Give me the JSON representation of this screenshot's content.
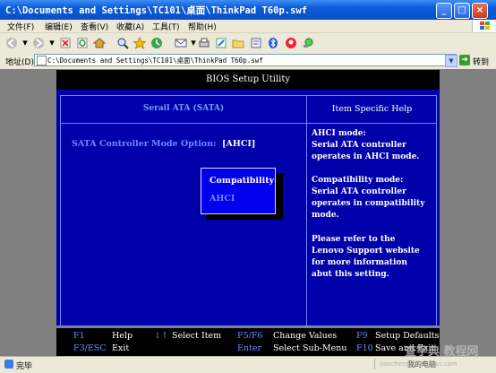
{
  "window": {
    "title": "C:\\Documents and Settings\\TC101\\桌面\\ThinkPad T60p.swf",
    "minimize": "_",
    "maximize": "□",
    "close": "×"
  },
  "menu": [
    "文件(F)",
    "编辑(E)",
    "查看(V)",
    "收藏(A)",
    "工具(T)",
    "帮助(H)"
  ],
  "address": {
    "label": "地址(D)",
    "value": "C:\\Documents and Settings\\TC101\\桌面\\ThinkPad T60p.swf",
    "go_label": "转到"
  },
  "toolbar_icons": [
    "back-icon",
    "forward-icon",
    "stop-icon",
    "refresh-icon",
    "home-icon",
    "search-icon",
    "favorites-icon",
    "history-icon",
    "mail-icon",
    "print-icon",
    "edit-icon",
    "folder-icon",
    "discuss-icon",
    "bluetooth-icon",
    "messenger-icon",
    "research-icon"
  ],
  "bios": {
    "title": "BIOS Setup Utility",
    "section_title": "Serail ATA (SATA)",
    "help_title": "Item Specific Help",
    "option_label": "SATA Controller Mode Option:",
    "option_value": "[AHCI]",
    "popup_options": [
      "Compatibility",
      "AHCI"
    ],
    "help_lines": [
      "AHCI mode:",
      "Serial ATA controller",
      "operates in AHCI mode.",
      "",
      "Compatibility mode:",
      "Serial ATA controller",
      "operates in compatibility",
      "mode.",
      "",
      "Please refer to the",
      "Lenovo Support website",
      "for more information",
      "abut this setting."
    ],
    "footer": {
      "f1_key": "F1",
      "f1_desc": "Help",
      "arrows_key": "↓↑",
      "arrows_desc": "Select Item",
      "f5f6_key": "F5/F6",
      "f5f6_desc": "Change Values",
      "f9_key": "F9",
      "f9_desc": "Setup Defaults",
      "f3_key": "F3/ESC",
      "f3_desc": "Exit",
      "enter_key": "Enter",
      "enter_desc": "Select Sub-Menu",
      "f10_key": "F10",
      "f10_desc": "Save and Exit"
    }
  },
  "status": {
    "text": "完毕",
    "zone": "我的电脑"
  },
  "watermark": {
    "text": "查字典 教程网",
    "url": "jiaocheng.chazidian.com"
  }
}
